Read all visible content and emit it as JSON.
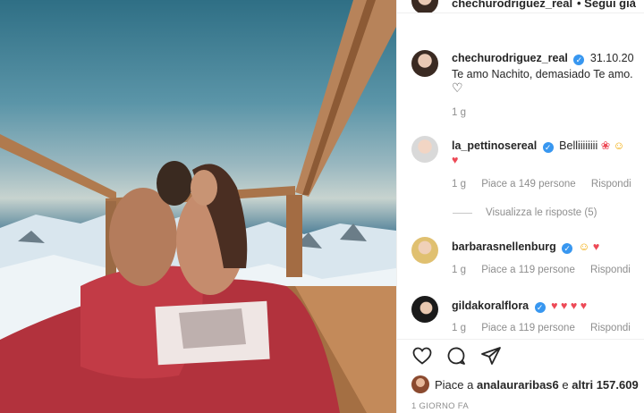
{
  "header": {
    "username": "chechurodriguez_real",
    "follow_label": "• Segui già"
  },
  "caption": {
    "username": "chechurodriguez_real",
    "date": "31.10.20",
    "text": "Te amo Nachito, demasiado Te amo.",
    "age": "1 g"
  },
  "comments": [
    {
      "username": "la_pettinosereal",
      "text": "Belliiiiiiii",
      "age": "1 g",
      "likes": "Piace a 149 persone",
      "reply": "Rispondi"
    },
    {
      "username": "barbarasnellenburg",
      "text": "",
      "age": "1 g",
      "likes": "Piace a 119 persone",
      "reply": "Rispondi"
    },
    {
      "username": "gildakoralflora",
      "text": "",
      "age": "1 g",
      "likes": "Piace a 119 persone",
      "reply": "Rispondi"
    }
  ],
  "view_replies": "Visualizza le risposte (5)",
  "likes_summary": {
    "prefix": "Piace a ",
    "user": "analauraribas6",
    "middle": " e ",
    "others": "altri 157.609"
  },
  "time_ago": "1 GIORNO FA",
  "colors": {
    "verified": "#3897f0",
    "heart_red": "#ed4956",
    "meta_gray": "#8e8e8e",
    "text": "#262626"
  },
  "icons": [
    "heart-icon",
    "comment-icon",
    "share-icon",
    "verified-icon"
  ]
}
